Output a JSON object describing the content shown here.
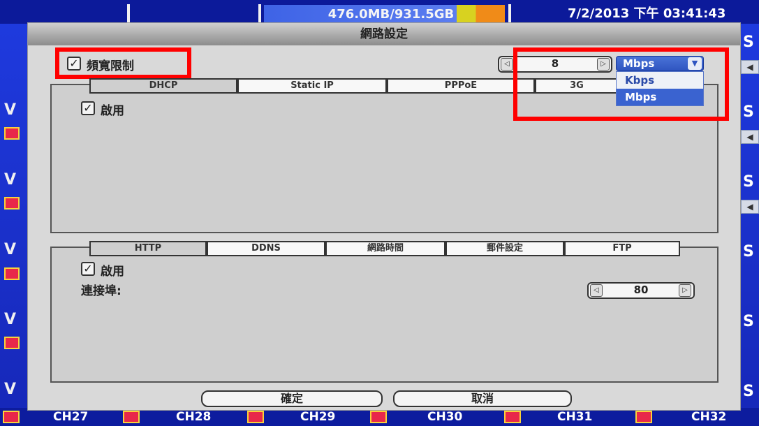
{
  "status_bar": {
    "storage": "476.0MB/931.5GB",
    "datetime": "7/2/2013 下午 03:41:43"
  },
  "dialog": {
    "title": "網路設定",
    "bandwidth_limit": {
      "label": "頻寬限制",
      "checked": true,
      "value": "8",
      "unit_selected": "Mbps",
      "unit_options": [
        "Kbps",
        "Mbps"
      ]
    },
    "network_tabs": [
      "DHCP",
      "Static IP",
      "PPPoE",
      "3G"
    ],
    "network_enable_label": "啟用",
    "service_tabs": [
      "HTTP",
      "DDNS",
      "網路時間",
      "郵件設定",
      "FTP"
    ],
    "service_enable_label": "啟用",
    "port_label": "連接埠:",
    "port_value": "80",
    "ok_label": "確定",
    "cancel_label": "取消"
  },
  "channels": [
    "CH27",
    "CH28",
    "CH29",
    "CH30",
    "CH31",
    "CH32"
  ],
  "colors": {
    "background": "#1a2fd0",
    "highlight_red": "#ff0000",
    "select_blue": "#2f55c0"
  }
}
